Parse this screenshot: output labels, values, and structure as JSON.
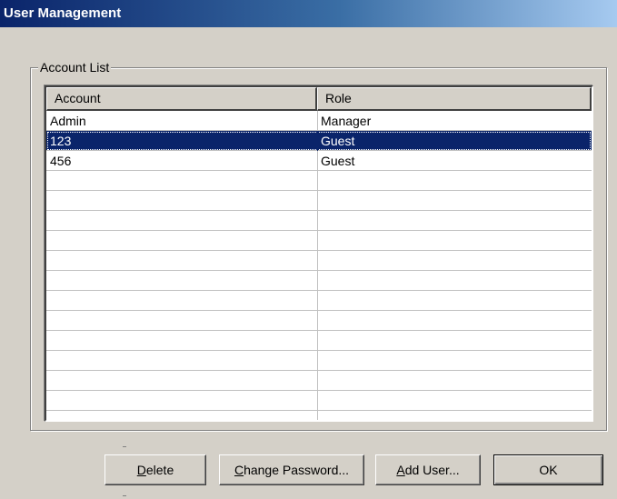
{
  "window": {
    "title": "User Management"
  },
  "account_list": {
    "legend": "Account List",
    "columns": [
      "Account",
      "Role"
    ],
    "rows": [
      {
        "account": "Admin",
        "role": "Manager",
        "selected": false
      },
      {
        "account": "123",
        "role": "Guest",
        "selected": true
      },
      {
        "account": "456",
        "role": "Guest",
        "selected": false
      }
    ],
    "empty_row_count": 13
  },
  "buttons": {
    "delete": {
      "accel": "D",
      "rest": "elete"
    },
    "change_password": {
      "accel": "C",
      "rest": "hange Password..."
    },
    "add_user": {
      "accel": "A",
      "rest": "dd User..."
    },
    "ok": {
      "label": "OK"
    }
  },
  "colors": {
    "selection": "#0a246a",
    "face": "#d4d0c8",
    "title_gradient_start": "#0a246a",
    "title_gradient_end": "#a6caf0"
  }
}
